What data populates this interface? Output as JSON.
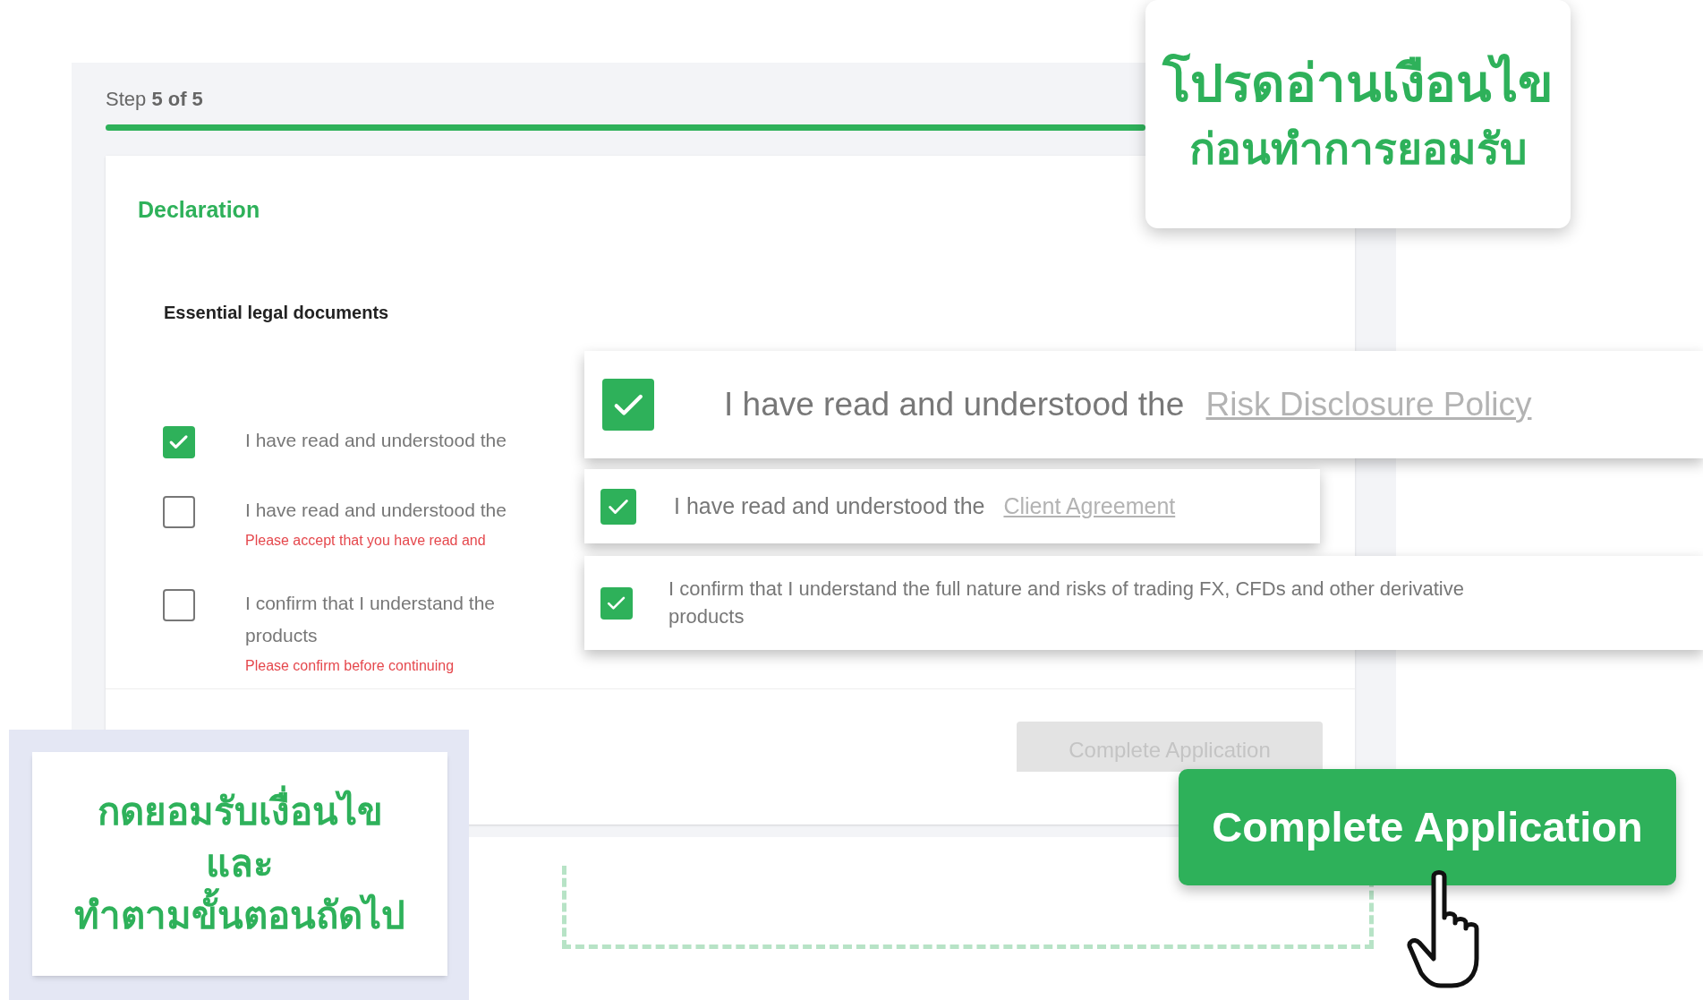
{
  "form": {
    "step": {
      "label": "Step **5 of 5**",
      "level": 1
    },
    "section_title": "Declaration",
    "group_title": "Essential legal documents",
    "items": [
      {
        "text": "I have read and understood the",
        "checked": true
      },
      {
        "text": "I have read and understood the",
        "checked": false,
        "error": "Please accept that you have read and"
      },
      {
        "text": "I confirm that I understand the\nproducts",
        "checked": false,
        "error": "Please confirm before continuing"
      }
    ],
    "button": {
      "label": "Complete Application",
      "disabled": true
    }
  },
  "top_callout": {
    "lines": [
      "โปรดอ่านเงือนไข",
      "ก่อนทำการยอมรับ"
    ]
  },
  "zoomed_items": [
    {
      "text": "I have read and understood the",
      "link": "Risk Disclosure Policy",
      "checked": true
    },
    {
      "text": "I have read and understood the",
      "link": "Client Agreement",
      "checked": true
    },
    {
      "text": "I confirm that I understand the full nature and risks of trading FX, CFDs and other derivative products",
      "checked": true
    }
  ],
  "bottom_callout": {
    "lines": [
      "กดยอมรับเงื่อนไข",
      "และ",
      "ทำตามขั้นตอนถัดไป"
    ]
  },
  "cta_button": {
    "label": "Complete Application"
  }
}
